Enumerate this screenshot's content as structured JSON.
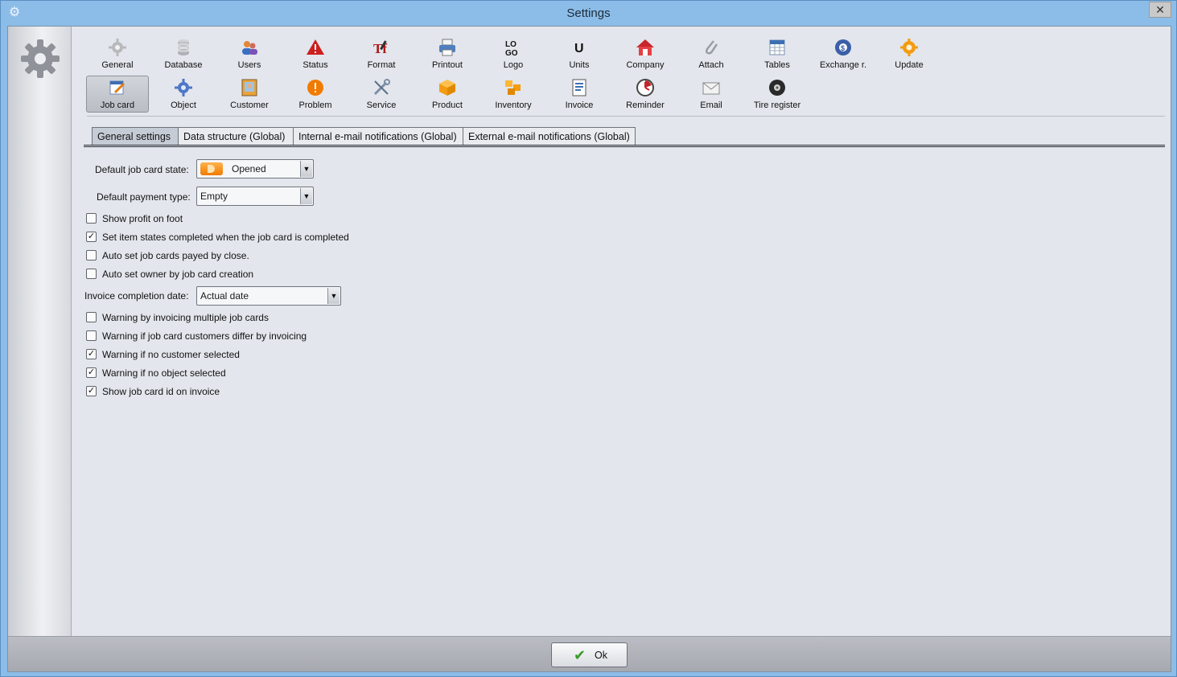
{
  "window": {
    "title": "Settings",
    "close_label": "✕"
  },
  "toolbar": {
    "row1": [
      {
        "label": "General",
        "icon": "gear-icon"
      },
      {
        "label": "Database",
        "icon": "database-icon"
      },
      {
        "label": "Users",
        "icon": "users-icon"
      },
      {
        "label": "Status",
        "icon": "warning-triangle-icon"
      },
      {
        "label": "Format",
        "icon": "format-icon"
      },
      {
        "label": "Printout",
        "icon": "printer-icon"
      },
      {
        "label": "Logo",
        "icon": "logo-icon",
        "glyph": "LO GO"
      },
      {
        "label": "Units",
        "icon": "units-icon",
        "glyph": "U"
      },
      {
        "label": "Company",
        "icon": "house-icon"
      },
      {
        "label": "Attach",
        "icon": "paperclip-icon"
      },
      {
        "label": "Tables",
        "icon": "table-icon"
      },
      {
        "label": "Exchange r.",
        "icon": "exchange-icon"
      },
      {
        "label": "Update",
        "icon": "update-icon"
      }
    ],
    "row2": [
      {
        "label": "Job card",
        "icon": "job-card-icon",
        "selected": true
      },
      {
        "label": "Object",
        "icon": "cog-object-icon"
      },
      {
        "label": "Customer",
        "icon": "customer-icon"
      },
      {
        "label": "Problem",
        "icon": "exclamation-icon"
      },
      {
        "label": "Service",
        "icon": "tools-icon"
      },
      {
        "label": "Product",
        "icon": "box-icon"
      },
      {
        "label": "Inventory",
        "icon": "boxes-icon"
      },
      {
        "label": "Invoice",
        "icon": "invoice-icon"
      },
      {
        "label": "Reminder",
        "icon": "clock-icon"
      },
      {
        "label": "Email",
        "icon": "envelope-icon"
      },
      {
        "label": "Tire register",
        "icon": "tire-icon"
      }
    ]
  },
  "tabs": [
    {
      "label": "General settings",
      "active": true
    },
    {
      "label": "Data structure (Global)"
    },
    {
      "label": "Internal e-mail notifications (Global)"
    },
    {
      "label": "External e-mail notifications (Global)"
    }
  ],
  "form": {
    "default_state_label": "Default job card state:",
    "default_state_value": "Opened",
    "payment_label": "Default payment type:",
    "payment_value": "Empty",
    "invoice_date_label": "Invoice completion date:",
    "invoice_date_value": "Actual date",
    "dropdown_arrow": "▼",
    "checks_a": [
      {
        "label": "Show profit on foot",
        "checked": false
      },
      {
        "label": "Set item states completed when the job card is completed",
        "checked": true
      },
      {
        "label": "Auto set job cards payed by close.",
        "checked": false
      },
      {
        "label": "Auto set owner by job card creation",
        "checked": false
      }
    ],
    "checks_b": [
      {
        "label": "Warning by invoicing multiple job cards",
        "checked": false
      },
      {
        "label": "Warning if job card customers differ by invoicing",
        "checked": false
      },
      {
        "label": "Warning if no customer selected",
        "checked": true
      },
      {
        "label": "Warning if no object selected",
        "checked": true
      },
      {
        "label": "Show job card id on invoice",
        "checked": true
      }
    ]
  },
  "footer": {
    "ok_label": "Ok"
  },
  "colors": {
    "titlebar": "#8cbde8",
    "accent_orange": "#f07b00",
    "check_green": "#3a9a2a"
  }
}
